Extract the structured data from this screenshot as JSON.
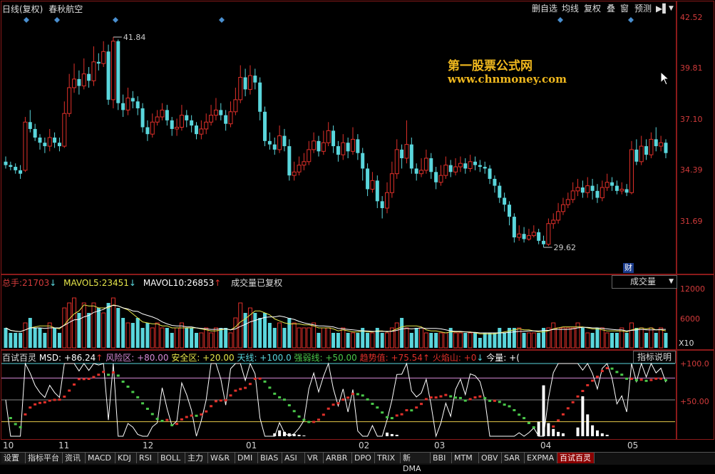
{
  "header": {
    "chart_kind": "日线(复权)",
    "stock_name": "春秋航空",
    "buttons": [
      "删自选",
      "均线",
      "复权",
      "叠",
      "窗",
      "预测"
    ],
    "play_icon": "▶▌",
    "dropdown_icon": "▼"
  },
  "watermark": {
    "line1": "第一股票公式网",
    "line2": "www.chnmoney.com"
  },
  "price_axis": [
    "42.52",
    "39.81",
    "37.10",
    "34.39",
    "31.69"
  ],
  "price_high": {
    "label": "41.84"
  },
  "price_low": {
    "label": "29.62"
  },
  "cai_badge": "财",
  "volume_panel": {
    "total_label": "总手:",
    "total_value": "21703",
    "mavol5_label": "MAVOL5:",
    "mavol5_value": "23451",
    "mavol10_label": "MAVOL10:",
    "mavol10_value": "26853",
    "note": "成交量已复权",
    "dropdown": "成交量",
    "axis": [
      "12000",
      "6000"
    ],
    "unit": "X10"
  },
  "indicator_panel": {
    "name": "百试百灵",
    "msd": "MSD: +86.24",
    "fengxian": "风险区: +80.00",
    "anquan": "安全区: +20.00",
    "tianxian": "天线: +100.0",
    "qiangruo": "强弱线: +50.00",
    "qushi": "趋势值: +75.54",
    "huoyan": "火焰山: +0",
    "jinliang": "今量: +(",
    "help_button": "指标说明",
    "axis": [
      "+100.0",
      "+50.00"
    ]
  },
  "months": [
    "10",
    "11",
    "12",
    "01",
    "02",
    "03",
    "04",
    "05"
  ],
  "tabs": [
    "设置",
    "指标平台",
    "资讯",
    "MACD",
    "KDJ",
    "RSI",
    "BOLL",
    "主力",
    "W&R",
    "DMI",
    "BIAS",
    "ASI",
    "VR",
    "ARBR",
    "DPO",
    "TRIX",
    "新DMA",
    "BBI",
    "MTM",
    "OBV",
    "SAR",
    "EXPMA",
    "百试百灵"
  ],
  "colors": {
    "up": "#e0302a",
    "down": "#5ad6dc",
    "white": "#ffffff",
    "frame": "#8b1a1a",
    "yellow_axis": "#e6c94a",
    "watermark": "#f0b81e"
  },
  "chart_data": {
    "type": "candlestick",
    "ylim": [
      29.0,
      43.0
    ],
    "high": 41.84,
    "low": 29.62,
    "candles": [
      [
        34.6,
        34.4,
        34.9,
        34.2
      ],
      [
        34.4,
        34.3,
        34.6,
        34.1
      ],
      [
        34.3,
        34.1,
        34.5,
        33.9
      ],
      [
        34.1,
        33.9,
        34.4,
        33.6
      ],
      [
        34.1,
        36.9,
        37.2,
        34.0
      ],
      [
        36.9,
        36.5,
        37.6,
        36.3
      ],
      [
        36.5,
        36.0,
        36.8,
        35.8
      ],
      [
        36.0,
        35.7,
        36.2,
        35.3
      ],
      [
        35.7,
        35.5,
        36.0,
        35.1
      ],
      [
        35.5,
        36.0,
        36.5,
        35.2
      ],
      [
        36.0,
        35.7,
        36.3,
        35.4
      ],
      [
        35.7,
        35.5,
        36.0,
        35.2
      ],
      [
        35.5,
        37.4,
        38.1,
        35.4
      ],
      [
        37.4,
        38.9,
        39.7,
        37.2
      ],
      [
        38.9,
        39.4,
        40.3,
        38.6
      ],
      [
        39.4,
        39.0,
        39.9,
        38.5
      ],
      [
        39.0,
        39.7,
        40.6,
        38.8
      ],
      [
        39.7,
        39.3,
        40.1,
        38.9
      ],
      [
        39.3,
        40.4,
        41.3,
        39.0
      ],
      [
        40.4,
        40.3,
        40.9,
        39.9
      ],
      [
        40.3,
        41.0,
        41.6,
        40.1
      ],
      [
        41.0,
        38.2,
        41.4,
        37.9
      ],
      [
        38.2,
        41.6,
        41.84,
        37.7
      ],
      [
        41.6,
        38.0,
        41.7,
        37.6
      ],
      [
        38.0,
        37.6,
        38.5,
        37.2
      ],
      [
        37.6,
        38.3,
        38.9,
        37.3
      ],
      [
        38.3,
        38.1,
        38.7,
        37.7
      ],
      [
        38.1,
        37.7,
        38.4,
        37.3
      ],
      [
        37.7,
        36.6,
        38.0,
        36.3
      ],
      [
        36.6,
        36.2,
        37.0,
        35.8
      ],
      [
        36.2,
        36.9,
        37.4,
        36.0
      ],
      [
        36.9,
        37.2,
        37.6,
        36.7
      ],
      [
        37.2,
        37.6,
        38.0,
        37.0
      ],
      [
        37.6,
        37.0,
        37.9,
        36.7
      ],
      [
        37.0,
        36.5,
        37.2,
        36.1
      ],
      [
        36.5,
        36.6,
        37.1,
        36.1
      ],
      [
        36.6,
        37.3,
        37.9,
        36.4
      ],
      [
        37.3,
        37.0,
        37.6,
        36.6
      ],
      [
        37.0,
        36.7,
        37.3,
        36.3
      ],
      [
        36.7,
        36.2,
        36.9,
        35.9
      ],
      [
        36.2,
        36.5,
        37.0,
        35.9
      ],
      [
        36.5,
        36.9,
        37.4,
        36.2
      ],
      [
        36.9,
        37.3,
        37.9,
        36.7
      ],
      [
        37.3,
        37.6,
        38.3,
        37.0
      ],
      [
        37.6,
        37.3,
        38.0,
        37.0
      ],
      [
        37.3,
        36.8,
        37.6,
        36.4
      ],
      [
        36.8,
        37.5,
        38.1,
        36.6
      ],
      [
        37.5,
        38.2,
        38.9,
        37.3
      ],
      [
        38.2,
        39.5,
        40.2,
        38.0
      ],
      [
        39.5,
        38.8,
        40.0,
        38.4
      ],
      [
        38.8,
        39.6,
        40.2,
        38.5
      ],
      [
        39.6,
        39.2,
        40.0,
        38.8
      ],
      [
        39.2,
        37.5,
        39.5,
        37.0
      ],
      [
        37.5,
        35.8,
        37.8,
        35.5
      ],
      [
        35.8,
        35.6,
        36.3,
        35.3
      ],
      [
        35.6,
        35.3,
        36.0,
        35.0
      ],
      [
        35.3,
        36.1,
        36.7,
        35.1
      ],
      [
        36.1,
        35.5,
        36.5,
        35.2
      ],
      [
        35.5,
        33.8,
        35.9,
        33.5
      ],
      [
        33.8,
        34.0,
        34.6,
        33.5
      ],
      [
        34.0,
        34.4,
        34.9,
        33.8
      ],
      [
        34.4,
        34.6,
        35.1,
        34.1
      ],
      [
        34.6,
        35.3,
        35.8,
        34.4
      ],
      [
        35.3,
        35.8,
        36.3,
        35.1
      ],
      [
        35.8,
        35.2,
        36.1,
        34.9
      ],
      [
        35.2,
        35.7,
        36.4,
        35.0
      ],
      [
        35.7,
        36.4,
        36.9,
        35.5
      ],
      [
        36.4,
        35.5,
        36.7,
        35.1
      ],
      [
        35.5,
        35.0,
        35.8,
        34.6
      ],
      [
        35.0,
        35.7,
        36.2,
        34.7
      ],
      [
        35.7,
        35.2,
        36.0,
        34.8
      ],
      [
        35.2,
        35.9,
        36.6,
        35.0
      ],
      [
        35.9,
        35.1,
        36.2,
        34.7
      ],
      [
        35.1,
        34.2,
        35.4,
        33.5
      ],
      [
        34.2,
        33.0,
        34.5,
        32.6
      ],
      [
        33.0,
        33.5,
        34.0,
        32.8
      ],
      [
        33.5,
        32.3,
        33.8,
        31.9
      ],
      [
        32.3,
        31.9,
        32.6,
        31.3
      ],
      [
        31.9,
        32.8,
        33.4,
        31.6
      ],
      [
        32.8,
        33.9,
        34.6,
        32.5
      ],
      [
        33.9,
        35.3,
        35.9,
        33.6
      ],
      [
        35.3,
        34.8,
        35.6,
        34.2
      ],
      [
        34.8,
        35.6,
        37.0,
        34.5
      ],
      [
        35.6,
        34.2,
        36.0,
        33.9
      ],
      [
        34.2,
        33.9,
        34.5,
        33.5
      ],
      [
        33.9,
        34.1,
        34.8,
        33.7
      ],
      [
        34.1,
        34.8,
        35.3,
        33.9
      ],
      [
        34.8,
        34.0,
        35.1,
        33.6
      ],
      [
        34.0,
        33.4,
        34.3,
        33.0
      ],
      [
        33.4,
        33.8,
        34.4,
        33.2
      ],
      [
        33.8,
        34.4,
        34.9,
        33.6
      ],
      [
        34.4,
        34.0,
        34.7,
        33.7
      ],
      [
        34.0,
        34.3,
        34.8,
        33.8
      ],
      [
        34.3,
        34.5,
        34.9,
        34.0
      ],
      [
        34.5,
        34.2,
        34.8,
        33.9
      ],
      [
        34.2,
        34.6,
        35.0,
        34.0
      ],
      [
        34.6,
        34.4,
        34.9,
        34.1
      ],
      [
        34.4,
        34.3,
        34.7,
        34.0
      ],
      [
        34.3,
        34.2,
        34.6,
        33.9
      ],
      [
        34.2,
        33.6,
        34.4,
        33.3
      ],
      [
        33.6,
        33.2,
        33.8,
        32.8
      ],
      [
        33.2,
        32.5,
        33.4,
        32.2
      ],
      [
        32.5,
        32.1,
        32.8,
        31.7
      ],
      [
        32.1,
        31.4,
        32.3,
        30.9
      ],
      [
        31.4,
        30.2,
        31.6,
        29.9
      ],
      [
        30.2,
        30.4,
        30.9,
        30.0
      ],
      [
        30.4,
        30.1,
        30.8,
        29.9
      ],
      [
        30.1,
        30.3,
        30.7,
        30.0
      ],
      [
        30.3,
        30.5,
        30.9,
        30.2
      ],
      [
        30.5,
        30.0,
        30.7,
        29.8
      ],
      [
        30.0,
        29.8,
        30.3,
        29.62
      ],
      [
        29.8,
        31.0,
        31.3,
        29.7
      ],
      [
        31.0,
        31.2,
        31.6,
        30.7
      ],
      [
        31.2,
        31.7,
        32.2,
        31.0
      ],
      [
        31.7,
        32.1,
        32.5,
        31.5
      ],
      [
        32.1,
        32.4,
        32.8,
        31.9
      ],
      [
        32.4,
        32.9,
        33.4,
        32.2
      ],
      [
        32.9,
        33.1,
        33.6,
        32.6
      ],
      [
        33.1,
        32.8,
        33.5,
        32.5
      ],
      [
        32.8,
        33.2,
        33.7,
        32.5
      ],
      [
        33.2,
        32.9,
        33.6,
        32.4
      ],
      [
        32.9,
        32.5,
        33.3,
        32.2
      ],
      [
        32.5,
        33.1,
        33.5,
        32.3
      ],
      [
        33.1,
        33.4,
        33.9,
        32.9
      ],
      [
        33.4,
        33.2,
        33.7,
        32.9
      ],
      [
        33.2,
        32.9,
        33.5,
        32.7
      ],
      [
        32.9,
        33.0,
        33.4,
        32.7
      ],
      [
        33.0,
        32.8,
        33.3,
        32.6
      ],
      [
        32.8,
        35.3,
        35.8,
        32.7
      ],
      [
        35.3,
        34.6,
        35.9,
        34.4
      ],
      [
        34.6,
        35.5,
        36.1,
        34.4
      ],
      [
        35.5,
        35.0,
        35.9,
        34.7
      ],
      [
        35.0,
        35.9,
        36.3,
        34.8
      ],
      [
        35.9,
        35.5,
        36.6,
        35.2
      ],
      [
        35.5,
        35.7,
        36.1,
        35.2
      ],
      [
        35.7,
        35.1,
        35.9,
        34.8
      ]
    ],
    "volume": [
      4,
      3,
      3,
      3,
      5,
      6,
      4,
      4,
      3,
      5,
      4,
      3,
      8,
      9,
      10,
      7,
      9,
      7,
      9,
      8,
      7,
      9,
      10,
      8,
      6,
      5,
      5,
      6,
      4,
      5,
      4,
      5,
      4,
      4,
      3,
      4,
      5,
      4,
      4,
      3,
      3,
      4,
      3,
      4,
      4,
      4,
      3,
      6,
      9,
      7,
      8,
      7,
      6,
      7,
      5,
      4,
      5,
      4,
      6,
      5,
      4,
      4,
      4,
      5,
      3,
      4,
      4,
      3,
      3,
      4,
      3,
      3,
      3,
      4,
      3,
      3,
      4,
      3,
      3,
      4,
      5,
      6,
      4,
      3,
      4,
      4,
      3,
      3,
      3,
      3,
      3,
      4,
      3,
      3,
      3,
      3,
      3,
      2,
      3,
      3,
      3,
      4,
      3,
      4,
      4,
      4,
      3,
      3,
      3,
      3,
      4,
      4,
      5,
      4,
      4,
      4,
      4,
      5,
      4,
      3,
      3,
      4,
      4,
      3,
      3,
      3,
      4,
      3,
      5,
      4,
      4,
      3,
      4,
      3,
      4,
      3
    ],
    "indicator_axis": [
      0,
      100
    ]
  }
}
